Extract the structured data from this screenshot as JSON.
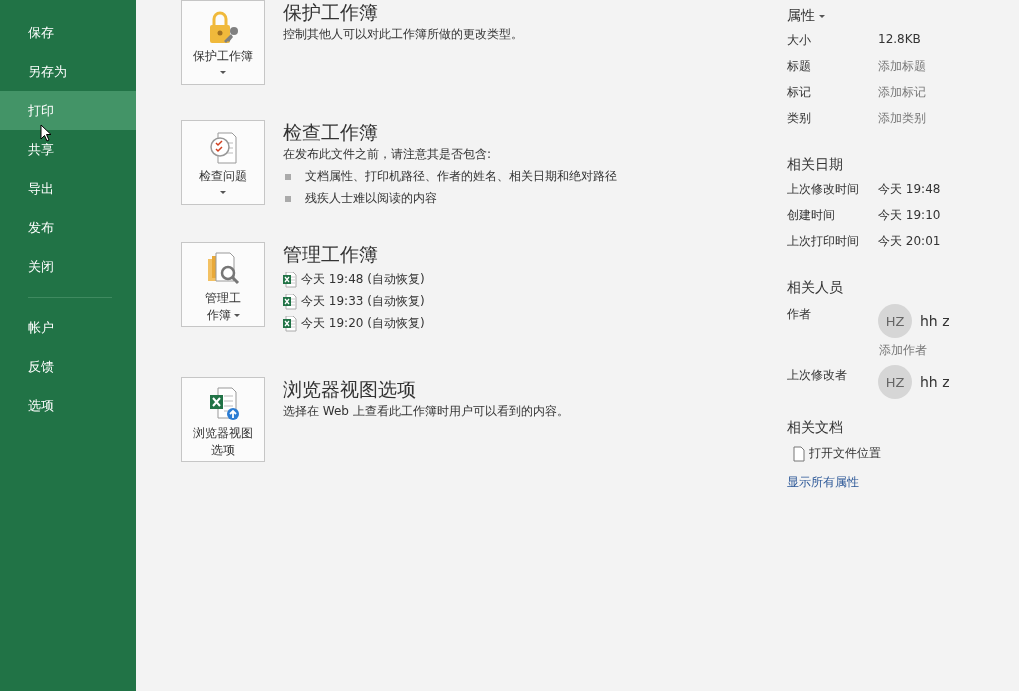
{
  "sidebar": {
    "items": [
      {
        "label": "保存",
        "selected": false
      },
      {
        "label": "另存为",
        "selected": false
      },
      {
        "label": "打印",
        "selected": true
      },
      {
        "label": "共享",
        "selected": false
      },
      {
        "label": "导出",
        "selected": false
      },
      {
        "label": "发布",
        "selected": false
      },
      {
        "label": "关闭",
        "selected": false
      }
    ],
    "footer_items": [
      {
        "label": "帐户",
        "selected": false
      },
      {
        "label": "反馈",
        "selected": false
      },
      {
        "label": "选项",
        "selected": false
      }
    ]
  },
  "sections": [
    {
      "kind": "protect",
      "button_label": "保护工作簿",
      "dropdown": true,
      "title": "保护工作簿",
      "description": "控制其他人可以对此工作簿所做的更改类型。"
    },
    {
      "kind": "inspect",
      "button_label": "检查问题",
      "dropdown": true,
      "title": "检查工作簿",
      "description": "在发布此文件之前，请注意其是否包含:",
      "bullets": [
        "文档属性、打印机路径、作者的姓名、相关日期和绝对路径",
        "残疾人士难以阅读的内容"
      ]
    },
    {
      "kind": "manage",
      "button_label": "管理工作簿",
      "dropdown": true,
      "title": "管理工作簿",
      "versions": [
        "今天 19:48 (自动恢复)",
        "今天 19:33 (自动恢复)",
        "今天 19:20 (自动恢复)"
      ]
    },
    {
      "kind": "browser",
      "button_label": "浏览器视图选项",
      "dropdown": false,
      "title": "浏览器视图选项",
      "description": "选择在 Web 上查看此工作簿时用户可以看到的内容。"
    }
  ],
  "properties": {
    "title": "属性",
    "rows": [
      {
        "label": "大小",
        "value": "12.8KB"
      },
      {
        "label": "标题",
        "placeholder": "添加标题"
      },
      {
        "label": "标记",
        "placeholder": "添加标记"
      },
      {
        "label": "类别",
        "placeholder": "添加类别"
      }
    ]
  },
  "dates": {
    "title": "相关日期",
    "rows": [
      {
        "label": "上次修改时间",
        "value": "今天 19:48"
      },
      {
        "label": "创建时间",
        "value": "今天 19:10"
      },
      {
        "label": "上次打印时间",
        "value": "今天 20:01"
      }
    ]
  },
  "people": {
    "title": "相关人员",
    "rows": [
      {
        "label": "作者",
        "initials": "HZ",
        "name": "hh z",
        "add_label": "添加作者"
      },
      {
        "label": "上次修改者",
        "initials": "HZ",
        "name": "hh z"
      }
    ]
  },
  "documents": {
    "title": "相关文档",
    "links": [
      "打开文件位置"
    ]
  },
  "show_all": "显示所有属性"
}
